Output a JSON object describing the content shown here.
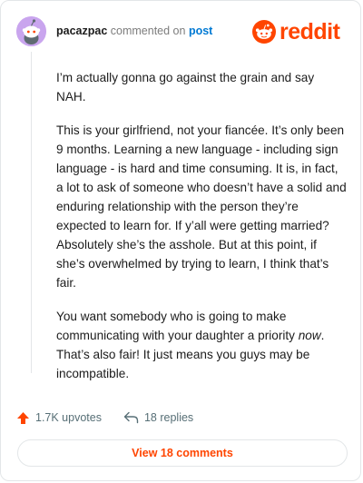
{
  "header": {
    "username": "pacazpac",
    "action_text": "commented on",
    "post_link": "post",
    "logo_text": "reddit"
  },
  "comment": {
    "paragraph_1": "I’m actually gonna go against the grain and say NAH.",
    "paragraph_2": "This is your girlfriend, not your fiancée. It’s only been 9 months. Learning a new language - including sign language - is hard and time consuming. It is, in fact, a lot to ask of someone who doesn’t have a solid and enduring relationship with the person they’re expected to learn for. If y’all were getting married? Absolutely she’s the asshole. But at this point, if she’s overwhelmed by trying to learn, I think that’s fair.",
    "paragraph_3_before": "You want somebody who is going to make communicating with your daughter a priority ",
    "paragraph_3_emphasis": "now",
    "paragraph_3_after": ". That’s also fair! It just means you guys may be incompatible."
  },
  "actions": {
    "upvotes": "1.7K upvotes",
    "replies": "18 replies"
  },
  "view_button": "View 18 comments",
  "colors": {
    "brand": "#ff4500",
    "link": "#0079d3",
    "avatar_bg": "#c9a5ee",
    "muted": "#576f76"
  },
  "icons": [
    "snoo-avatar-icon",
    "reddit-logo-icon",
    "upvote-arrow-icon",
    "reply-arrow-icon"
  ]
}
